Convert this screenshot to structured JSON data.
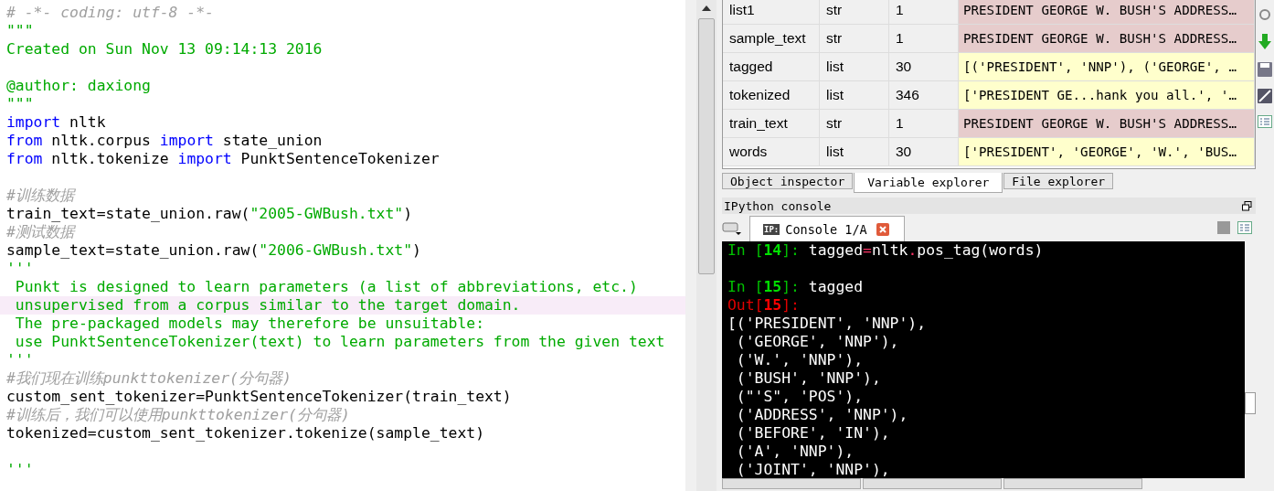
{
  "editor": {
    "lines": [
      {
        "current": false,
        "tokens": [
          {
            "kind": "cmt",
            "t": "# -*- coding: utf-8 -*-"
          }
        ]
      },
      {
        "current": false,
        "tokens": [
          {
            "kind": "str",
            "t": "\"\"\""
          }
        ]
      },
      {
        "current": false,
        "tokens": [
          {
            "kind": "str",
            "t": "Created on Sun Nov 13 09:14:13 2016"
          }
        ]
      },
      {
        "current": false
      },
      {
        "current": false,
        "tokens": [
          {
            "kind": "str",
            "t": "@author: daxiong"
          }
        ]
      },
      {
        "current": false,
        "tokens": [
          {
            "kind": "str",
            "t": "\"\"\""
          }
        ]
      },
      {
        "current": false,
        "tokens": [
          {
            "kind": "kw",
            "t": "import"
          },
          {
            "kind": "plain",
            "t": " nltk"
          }
        ]
      },
      {
        "current": false,
        "tokens": [
          {
            "kind": "kw",
            "t": "from"
          },
          {
            "kind": "plain",
            "t": " nltk.corpus "
          },
          {
            "kind": "kw",
            "t": "import"
          },
          {
            "kind": "plain",
            "t": " state_union"
          }
        ]
      },
      {
        "current": false,
        "tokens": [
          {
            "kind": "kw",
            "t": "from"
          },
          {
            "kind": "plain",
            "t": " nltk.tokenize "
          },
          {
            "kind": "kw",
            "t": "import"
          },
          {
            "kind": "plain",
            "t": " PunktSentenceTokenizer"
          }
        ]
      },
      {
        "current": false
      },
      {
        "current": false,
        "tokens": [
          {
            "kind": "cmt",
            "t": "#训练数据"
          }
        ]
      },
      {
        "current": false,
        "tokens": [
          {
            "kind": "plain",
            "t": "train_text=state_union.raw("
          },
          {
            "kind": "str",
            "t": "\"2005-GWBush.txt\""
          },
          {
            "kind": "plain",
            "t": ")"
          }
        ]
      },
      {
        "current": false,
        "tokens": [
          {
            "kind": "cmt",
            "t": "#测试数据"
          }
        ]
      },
      {
        "current": false,
        "tokens": [
          {
            "kind": "plain",
            "t": "sample_text=state_union.raw("
          },
          {
            "kind": "str",
            "t": "\"2006-GWBush.txt\""
          },
          {
            "kind": "plain",
            "t": ")"
          }
        ]
      },
      {
        "current": false,
        "tokens": [
          {
            "kind": "str",
            "t": "'''"
          }
        ]
      },
      {
        "current": false,
        "tokens": [
          {
            "kind": "str",
            "t": " Punkt is designed to learn parameters (a list of abbreviations, etc.)"
          }
        ]
      },
      {
        "current": true,
        "tokens": [
          {
            "kind": "str",
            "t": " unsupervised from a corpus similar to the target domain."
          }
        ]
      },
      {
        "current": false,
        "tokens": [
          {
            "kind": "str",
            "t": " The pre-packaged models may therefore be unsuitable:"
          }
        ]
      },
      {
        "current": false,
        "tokens": [
          {
            "kind": "str",
            "t": " use PunktSentenceTokenizer(text) to learn parameters from the given text"
          }
        ]
      },
      {
        "current": false,
        "tokens": [
          {
            "kind": "str",
            "t": "'''"
          }
        ]
      },
      {
        "current": false,
        "tokens": [
          {
            "kind": "cmt",
            "t": "#我们现在训练punkttokenizer(分句器)"
          }
        ]
      },
      {
        "current": false,
        "tokens": [
          {
            "kind": "plain",
            "t": "custom_sent_tokenizer=PunktSentenceTokenizer(train_text)"
          }
        ]
      },
      {
        "current": false,
        "tokens": [
          {
            "kind": "cmt",
            "t": "#训练后，我们可以使用punkttokenizer(分句器)"
          }
        ]
      },
      {
        "current": false,
        "tokens": [
          {
            "kind": "plain",
            "t": "tokenized=custom_sent_tokenizer.tokenize(sample_text)"
          }
        ]
      },
      {
        "current": false
      },
      {
        "current": false,
        "tokens": [
          {
            "kind": "str",
            "t": "'''"
          }
        ]
      }
    ]
  },
  "variables": [
    {
      "name": "list1",
      "type": "str",
      "size": "1",
      "value": "PRESIDENT GEORGE W. BUSH'S ADDRESS…",
      "color": "#e6cccc"
    },
    {
      "name": "sample_text",
      "type": "str",
      "size": "1",
      "value": "PRESIDENT GEORGE W. BUSH'S ADDRESS…",
      "color": "#e6cccc"
    },
    {
      "name": "tagged",
      "type": "list",
      "size": "30",
      "value": "[('PRESIDENT', 'NNP'), ('GEORGE', …",
      "color": "#ffffcc"
    },
    {
      "name": "tokenized",
      "type": "list",
      "size": "346",
      "value": "['PRESIDENT GE...hank you all.', '…",
      "color": "#ffffcc"
    },
    {
      "name": "train_text",
      "type": "str",
      "size": "1",
      "value": "PRESIDENT GEORGE W. BUSH'S ADDRESS…",
      "color": "#e6cccc"
    },
    {
      "name": "words",
      "type": "list",
      "size": "30",
      "value": "['PRESIDENT', 'GEORGE', 'W.', 'BUS…",
      "color": "#ffffcc"
    }
  ],
  "pane_tabs": [
    {
      "label": "Object inspector",
      "selected": false
    },
    {
      "label": "Variable explorer",
      "selected": true
    },
    {
      "label": "File explorer",
      "selected": false
    }
  ],
  "console_pane": {
    "title": "IPython console",
    "tab": {
      "badge": "IP:",
      "label": "Console 1/A",
      "selected": true
    }
  },
  "console": [
    {
      "lines": [
        {
          "tokens": [
            {
              "kind": "in",
              "t": "In ["
            },
            {
              "kind": "innum",
              "t": "14"
            },
            {
              "kind": "in",
              "t": "]: "
            },
            {
              "kind": "text",
              "t": "tagged"
            },
            {
              "kind": "op",
              "t": "="
            },
            {
              "kind": "text",
              "t": "nltk"
            },
            {
              "kind": "op",
              "t": "."
            },
            {
              "kind": "text",
              "t": "pos_tag(words)"
            }
          ]
        }
      ]
    },
    {
      "lines": [
        {
          "tokens": [
            {
              "kind": "in",
              "t": "In ["
            },
            {
              "kind": "innum",
              "t": "15"
            },
            {
              "kind": "in",
              "t": "]: "
            },
            {
              "kind": "text",
              "t": "tagged"
            }
          ]
        },
        {
          "tokens": [
            {
              "kind": "out",
              "t": "Out["
            },
            {
              "kind": "outnum",
              "t": "15"
            },
            {
              "kind": "out",
              "t": "]:"
            }
          ]
        },
        {
          "tokens": [
            {
              "kind": "text",
              "t": "[('PRESIDENT', 'NNP'),"
            }
          ]
        },
        {
          "tokens": [
            {
              "kind": "text",
              "t": " ('GEORGE', 'NNP'),"
            }
          ]
        },
        {
          "tokens": [
            {
              "kind": "text",
              "t": " ('W.', 'NNP'),"
            }
          ]
        },
        {
          "tokens": [
            {
              "kind": "text",
              "t": " ('BUSH', 'NNP'),"
            }
          ]
        },
        {
          "tokens": [
            {
              "kind": "text",
              "t": " (\"'S\", 'POS'),"
            }
          ]
        },
        {
          "tokens": [
            {
              "kind": "text",
              "t": " ('ADDRESS', 'NNP'),"
            }
          ]
        },
        {
          "tokens": [
            {
              "kind": "text",
              "t": " ('BEFORE', 'IN'),"
            }
          ]
        },
        {
          "tokens": [
            {
              "kind": "text",
              "t": " ('A', 'NNP'),"
            }
          ]
        },
        {
          "tokens": [
            {
              "kind": "text",
              "t": " ('JOINT', 'NNP'),"
            }
          ]
        }
      ]
    }
  ]
}
